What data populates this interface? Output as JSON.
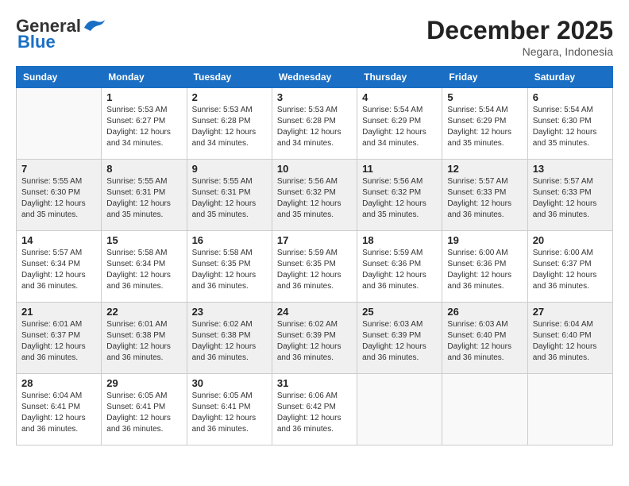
{
  "logo": {
    "line1": "General",
    "line2": "Blue"
  },
  "title": "December 2025",
  "subtitle": "Negara, Indonesia",
  "days_header": [
    "Sunday",
    "Monday",
    "Tuesday",
    "Wednesday",
    "Thursday",
    "Friday",
    "Saturday"
  ],
  "weeks": [
    [
      {
        "day": "",
        "info": ""
      },
      {
        "day": "1",
        "info": "Sunrise: 5:53 AM\nSunset: 6:27 PM\nDaylight: 12 hours\nand 34 minutes."
      },
      {
        "day": "2",
        "info": "Sunrise: 5:53 AM\nSunset: 6:28 PM\nDaylight: 12 hours\nand 34 minutes."
      },
      {
        "day": "3",
        "info": "Sunrise: 5:53 AM\nSunset: 6:28 PM\nDaylight: 12 hours\nand 34 minutes."
      },
      {
        "day": "4",
        "info": "Sunrise: 5:54 AM\nSunset: 6:29 PM\nDaylight: 12 hours\nand 34 minutes."
      },
      {
        "day": "5",
        "info": "Sunrise: 5:54 AM\nSunset: 6:29 PM\nDaylight: 12 hours\nand 35 minutes."
      },
      {
        "day": "6",
        "info": "Sunrise: 5:54 AM\nSunset: 6:30 PM\nDaylight: 12 hours\nand 35 minutes."
      }
    ],
    [
      {
        "day": "7",
        "info": "Sunrise: 5:55 AM\nSunset: 6:30 PM\nDaylight: 12 hours\nand 35 minutes."
      },
      {
        "day": "8",
        "info": "Sunrise: 5:55 AM\nSunset: 6:31 PM\nDaylight: 12 hours\nand 35 minutes."
      },
      {
        "day": "9",
        "info": "Sunrise: 5:55 AM\nSunset: 6:31 PM\nDaylight: 12 hours\nand 35 minutes."
      },
      {
        "day": "10",
        "info": "Sunrise: 5:56 AM\nSunset: 6:32 PM\nDaylight: 12 hours\nand 35 minutes."
      },
      {
        "day": "11",
        "info": "Sunrise: 5:56 AM\nSunset: 6:32 PM\nDaylight: 12 hours\nand 35 minutes."
      },
      {
        "day": "12",
        "info": "Sunrise: 5:57 AM\nSunset: 6:33 PM\nDaylight: 12 hours\nand 36 minutes."
      },
      {
        "day": "13",
        "info": "Sunrise: 5:57 AM\nSunset: 6:33 PM\nDaylight: 12 hours\nand 36 minutes."
      }
    ],
    [
      {
        "day": "14",
        "info": "Sunrise: 5:57 AM\nSunset: 6:34 PM\nDaylight: 12 hours\nand 36 minutes."
      },
      {
        "day": "15",
        "info": "Sunrise: 5:58 AM\nSunset: 6:34 PM\nDaylight: 12 hours\nand 36 minutes."
      },
      {
        "day": "16",
        "info": "Sunrise: 5:58 AM\nSunset: 6:35 PM\nDaylight: 12 hours\nand 36 minutes."
      },
      {
        "day": "17",
        "info": "Sunrise: 5:59 AM\nSunset: 6:35 PM\nDaylight: 12 hours\nand 36 minutes."
      },
      {
        "day": "18",
        "info": "Sunrise: 5:59 AM\nSunset: 6:36 PM\nDaylight: 12 hours\nand 36 minutes."
      },
      {
        "day": "19",
        "info": "Sunrise: 6:00 AM\nSunset: 6:36 PM\nDaylight: 12 hours\nand 36 minutes."
      },
      {
        "day": "20",
        "info": "Sunrise: 6:00 AM\nSunset: 6:37 PM\nDaylight: 12 hours\nand 36 minutes."
      }
    ],
    [
      {
        "day": "21",
        "info": "Sunrise: 6:01 AM\nSunset: 6:37 PM\nDaylight: 12 hours\nand 36 minutes."
      },
      {
        "day": "22",
        "info": "Sunrise: 6:01 AM\nSunset: 6:38 PM\nDaylight: 12 hours\nand 36 minutes."
      },
      {
        "day": "23",
        "info": "Sunrise: 6:02 AM\nSunset: 6:38 PM\nDaylight: 12 hours\nand 36 minutes."
      },
      {
        "day": "24",
        "info": "Sunrise: 6:02 AM\nSunset: 6:39 PM\nDaylight: 12 hours\nand 36 minutes."
      },
      {
        "day": "25",
        "info": "Sunrise: 6:03 AM\nSunset: 6:39 PM\nDaylight: 12 hours\nand 36 minutes."
      },
      {
        "day": "26",
        "info": "Sunrise: 6:03 AM\nSunset: 6:40 PM\nDaylight: 12 hours\nand 36 minutes."
      },
      {
        "day": "27",
        "info": "Sunrise: 6:04 AM\nSunset: 6:40 PM\nDaylight: 12 hours\nand 36 minutes."
      }
    ],
    [
      {
        "day": "28",
        "info": "Sunrise: 6:04 AM\nSunset: 6:41 PM\nDaylight: 12 hours\nand 36 minutes."
      },
      {
        "day": "29",
        "info": "Sunrise: 6:05 AM\nSunset: 6:41 PM\nDaylight: 12 hours\nand 36 minutes."
      },
      {
        "day": "30",
        "info": "Sunrise: 6:05 AM\nSunset: 6:41 PM\nDaylight: 12 hours\nand 36 minutes."
      },
      {
        "day": "31",
        "info": "Sunrise: 6:06 AM\nSunset: 6:42 PM\nDaylight: 12 hours\nand 36 minutes."
      },
      {
        "day": "",
        "info": ""
      },
      {
        "day": "",
        "info": ""
      },
      {
        "day": "",
        "info": ""
      }
    ]
  ]
}
